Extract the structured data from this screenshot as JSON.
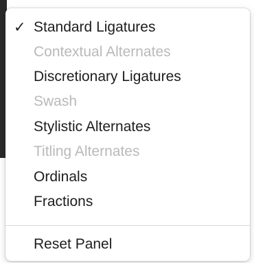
{
  "menu": {
    "items": [
      {
        "label": "Standard Ligatures",
        "checked": true,
        "enabled": true,
        "check_glyph": "✓"
      },
      {
        "label": "Contextual Alternates",
        "checked": false,
        "enabled": false
      },
      {
        "label": "Discretionary Ligatures",
        "checked": false,
        "enabled": true
      },
      {
        "label": "Swash",
        "checked": false,
        "enabled": false
      },
      {
        "label": "Stylistic Alternates",
        "checked": false,
        "enabled": true
      },
      {
        "label": "Titling Alternates",
        "checked": false,
        "enabled": false
      },
      {
        "label": "Ordinals",
        "checked": false,
        "enabled": true
      },
      {
        "label": "Fractions",
        "checked": false,
        "enabled": true
      }
    ],
    "reset": {
      "label": "Reset Panel",
      "enabled": true
    }
  },
  "colors": {
    "text": "#1d1d1d",
    "disabled_text": "#b9b9b9",
    "separator": "#d8d8d8"
  }
}
